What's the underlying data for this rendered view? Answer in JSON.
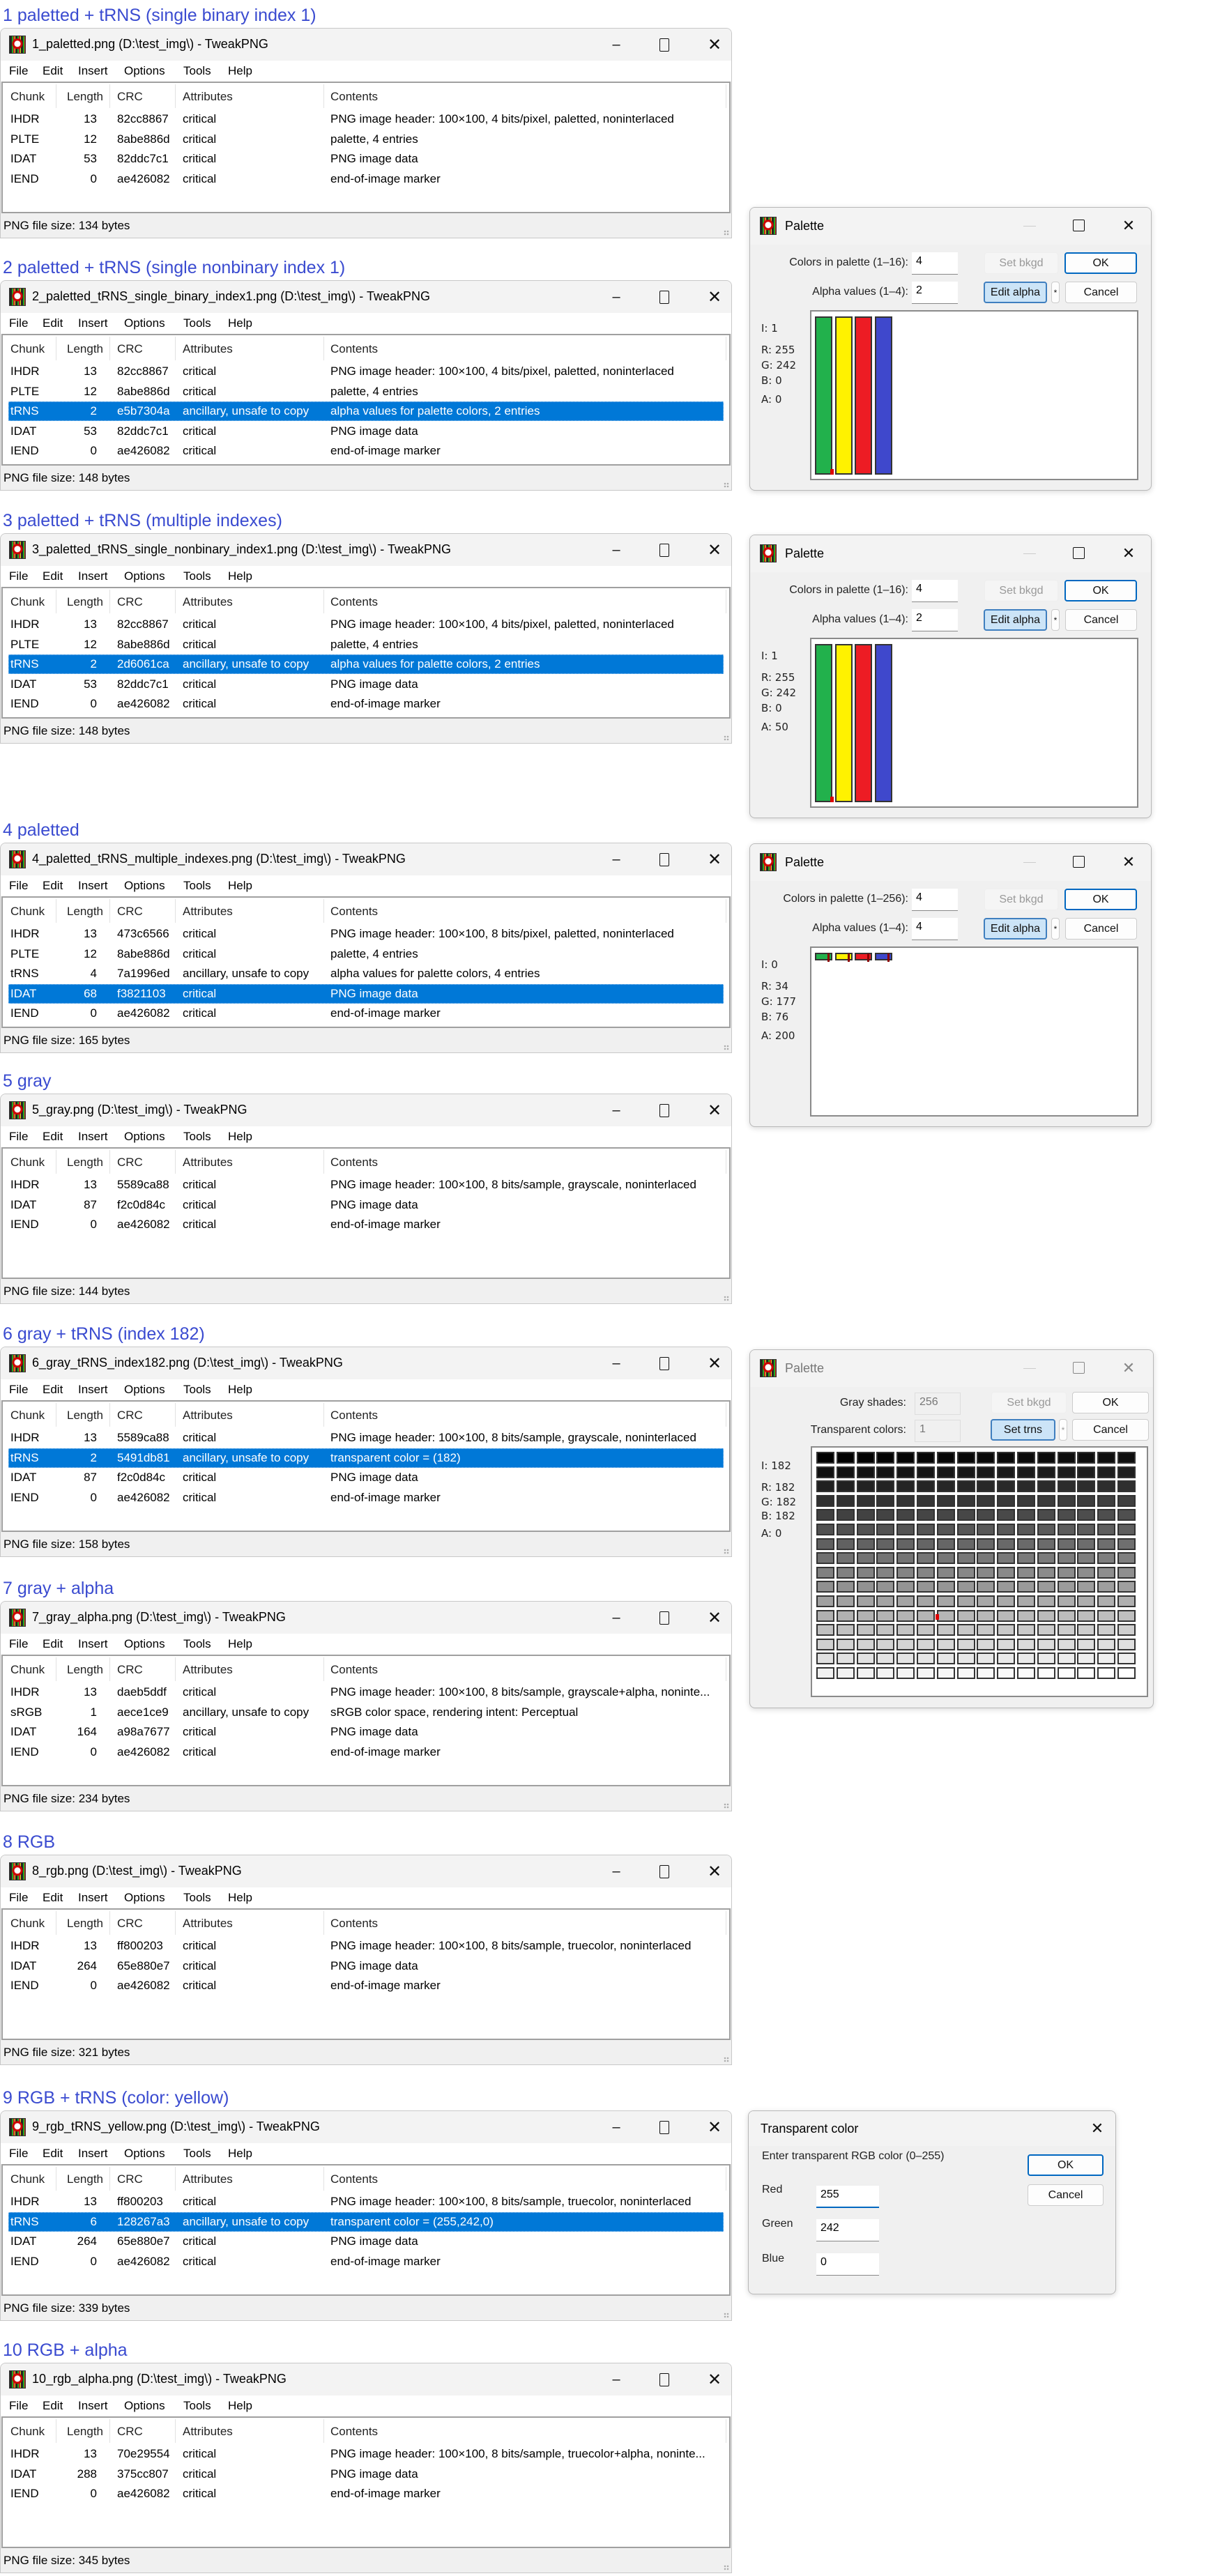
{
  "colors": {
    "accent": "#0078d7",
    "heading": "#3a4bd0"
  },
  "menu": [
    "File",
    "Edit",
    "Insert",
    "Options",
    "Tools",
    "Help"
  ],
  "columns": [
    "Chunk",
    "Length",
    "CRC",
    "Attributes",
    "Contents"
  ],
  "windows": [
    {
      "heading": "1 paletted + tRNS (single binary index 1)",
      "title": "1_paletted.png (D:\\test_img\\) - TweakPNG",
      "selected": -1,
      "status": "PNG file size: 134 bytes",
      "rows": [
        {
          "chunk": "IHDR",
          "length": "13",
          "crc": "82cc8867",
          "attributes": "critical",
          "contents": "PNG image header: 100×100, 4 bits/pixel, paletted, noninterlaced"
        },
        {
          "chunk": "PLTE",
          "length": "12",
          "crc": "8abe886d",
          "attributes": "critical",
          "contents": "palette, 4 entries"
        },
        {
          "chunk": "IDAT",
          "length": "53",
          "crc": "82ddc7c1",
          "attributes": "critical",
          "contents": "PNG image data"
        },
        {
          "chunk": "IEND",
          "length": "0",
          "crc": "ae426082",
          "attributes": "critical",
          "contents": "end-of-image marker"
        }
      ]
    },
    {
      "heading": "2 paletted + tRNS (single nonbinary index 1)",
      "title": "2_paletted_tRNS_single_binary_index1.png (D:\\test_img\\) - TweakPNG",
      "selected": 2,
      "status": "PNG file size: 148 bytes",
      "rows": [
        {
          "chunk": "IHDR",
          "length": "13",
          "crc": "82cc8867",
          "attributes": "critical",
          "contents": "PNG image header: 100×100, 4 bits/pixel, paletted, noninterlaced"
        },
        {
          "chunk": "PLTE",
          "length": "12",
          "crc": "8abe886d",
          "attributes": "critical",
          "contents": "palette, 4 entries"
        },
        {
          "chunk": "tRNS",
          "length": "2",
          "crc": "e5b7304a",
          "attributes": "ancillary, unsafe to copy",
          "contents": "alpha values for palette colors, 2 entries"
        },
        {
          "chunk": "IDAT",
          "length": "53",
          "crc": "82ddc7c1",
          "attributes": "critical",
          "contents": "PNG image data"
        },
        {
          "chunk": "IEND",
          "length": "0",
          "crc": "ae426082",
          "attributes": "critical",
          "contents": "end-of-image marker"
        }
      ]
    },
    {
      "heading": "3 paletted + tRNS (multiple indexes)",
      "title": "3_paletted_tRNS_single_nonbinary_index1.png (D:\\test_img\\) - TweakPNG",
      "selected": 2,
      "status": "PNG file size: 148 bytes",
      "rows": [
        {
          "chunk": "IHDR",
          "length": "13",
          "crc": "82cc8867",
          "attributes": "critical",
          "contents": "PNG image header: 100×100, 4 bits/pixel, paletted, noninterlaced"
        },
        {
          "chunk": "PLTE",
          "length": "12",
          "crc": "8abe886d",
          "attributes": "critical",
          "contents": "palette, 4 entries"
        },
        {
          "chunk": "tRNS",
          "length": "2",
          "crc": "2d6061ca",
          "attributes": "ancillary, unsafe to copy",
          "contents": "alpha values for palette colors, 2 entries"
        },
        {
          "chunk": "IDAT",
          "length": "53",
          "crc": "82ddc7c1",
          "attributes": "critical",
          "contents": "PNG image data"
        },
        {
          "chunk": "IEND",
          "length": "0",
          "crc": "ae426082",
          "attributes": "critical",
          "contents": "end-of-image marker"
        }
      ]
    },
    {
      "heading": "4 paletted",
      "title": "4_paletted_tRNS_multiple_indexes.png (D:\\test_img\\) - TweakPNG",
      "selected": 3,
      "status": "PNG file size: 165 bytes",
      "rows": [
        {
          "chunk": "IHDR",
          "length": "13",
          "crc": "473c6566",
          "attributes": "critical",
          "contents": "PNG image header: 100×100, 8 bits/pixel, paletted, noninterlaced"
        },
        {
          "chunk": "PLTE",
          "length": "12",
          "crc": "8abe886d",
          "attributes": "critical",
          "contents": "palette, 4 entries"
        },
        {
          "chunk": "tRNS",
          "length": "4",
          "crc": "7a1996ed",
          "attributes": "ancillary, unsafe to copy",
          "contents": "alpha values for palette colors, 4 entries"
        },
        {
          "chunk": "IDAT",
          "length": "68",
          "crc": "f3821103",
          "attributes": "critical",
          "contents": "PNG image data"
        },
        {
          "chunk": "IEND",
          "length": "0",
          "crc": "ae426082",
          "attributes": "critical",
          "contents": "end-of-image marker"
        }
      ]
    },
    {
      "heading": "5 gray",
      "title": "5_gray.png (D:\\test_img\\) - TweakPNG",
      "selected": -1,
      "status": "PNG file size: 144 bytes",
      "rows": [
        {
          "chunk": "IHDR",
          "length": "13",
          "crc": "5589ca88",
          "attributes": "critical",
          "contents": "PNG image header: 100×100, 8 bits/sample, grayscale, noninterlaced"
        },
        {
          "chunk": "IDAT",
          "length": "87",
          "crc": "f2c0d84c",
          "attributes": "critical",
          "contents": "PNG image data"
        },
        {
          "chunk": "IEND",
          "length": "0",
          "crc": "ae426082",
          "attributes": "critical",
          "contents": "end-of-image marker"
        }
      ]
    },
    {
      "heading": "6 gray + tRNS (index 182)",
      "title": "6_gray_tRNS_index182.png (D:\\test_img\\) - TweakPNG",
      "selected": 1,
      "status": "PNG file size: 158 bytes",
      "rows": [
        {
          "chunk": "IHDR",
          "length": "13",
          "crc": "5589ca88",
          "attributes": "critical",
          "contents": "PNG image header: 100×100, 8 bits/sample, grayscale, noninterlaced"
        },
        {
          "chunk": "tRNS",
          "length": "2",
          "crc": "5491db81",
          "attributes": "ancillary, unsafe to copy",
          "contents": "transparent color = (182)"
        },
        {
          "chunk": "IDAT",
          "length": "87",
          "crc": "f2c0d84c",
          "attributes": "critical",
          "contents": "PNG image data"
        },
        {
          "chunk": "IEND",
          "length": "0",
          "crc": "ae426082",
          "attributes": "critical",
          "contents": "end-of-image marker"
        }
      ]
    },
    {
      "heading": "7 gray + alpha",
      "title": "7_gray_alpha.png (D:\\test_img\\) - TweakPNG",
      "selected": -1,
      "status": "PNG file size: 234 bytes",
      "rows": [
        {
          "chunk": "IHDR",
          "length": "13",
          "crc": "daeb5ddf",
          "attributes": "critical",
          "contents": "PNG image header: 100×100, 8 bits/sample, grayscale+alpha, noninte..."
        },
        {
          "chunk": "sRGB",
          "length": "1",
          "crc": "aece1ce9",
          "attributes": "ancillary, unsafe to copy",
          "contents": "sRGB color space, rendering intent: Perceptual"
        },
        {
          "chunk": "IDAT",
          "length": "164",
          "crc": "a98a7677",
          "attributes": "critical",
          "contents": "PNG image data"
        },
        {
          "chunk": "IEND",
          "length": "0",
          "crc": "ae426082",
          "attributes": "critical",
          "contents": "end-of-image marker"
        }
      ]
    },
    {
      "heading": "8 RGB",
      "title": "8_rgb.png (D:\\test_img\\) - TweakPNG",
      "selected": -1,
      "status": "PNG file size: 321 bytes",
      "rows": [
        {
          "chunk": "IHDR",
          "length": "13",
          "crc": "ff800203",
          "attributes": "critical",
          "contents": "PNG image header: 100×100, 8 bits/sample, truecolor, noninterlaced"
        },
        {
          "chunk": "IDAT",
          "length": "264",
          "crc": "65e880e7",
          "attributes": "critical",
          "contents": "PNG image data"
        },
        {
          "chunk": "IEND",
          "length": "0",
          "crc": "ae426082",
          "attributes": "critical",
          "contents": "end-of-image marker"
        }
      ]
    },
    {
      "heading": "9 RGB + tRNS (color: yellow)",
      "title": "9_rgb_tRNS_yellow.png (D:\\test_img\\) - TweakPNG",
      "selected": 1,
      "status": "PNG file size: 339 bytes",
      "rows": [
        {
          "chunk": "IHDR",
          "length": "13",
          "crc": "ff800203",
          "attributes": "critical",
          "contents": "PNG image header: 100×100, 8 bits/sample, truecolor, noninterlaced"
        },
        {
          "chunk": "tRNS",
          "length": "6",
          "crc": "128267a3",
          "attributes": "ancillary, unsafe to copy",
          "contents": "transparent color = (255,242,0)"
        },
        {
          "chunk": "IDAT",
          "length": "264",
          "crc": "65e880e7",
          "attributes": "critical",
          "contents": "PNG image data"
        },
        {
          "chunk": "IEND",
          "length": "0",
          "crc": "ae426082",
          "attributes": "critical",
          "contents": "end-of-image marker"
        }
      ]
    },
    {
      "heading": "10 RGB + alpha",
      "title": "10_rgb_alpha.png (D:\\test_img\\) - TweakPNG",
      "selected": -1,
      "status": "PNG file size: 345 bytes",
      "rows": [
        {
          "chunk": "IHDR",
          "length": "13",
          "crc": "70e29554",
          "attributes": "critical",
          "contents": "PNG image header: 100×100, 8 bits/sample, truecolor+alpha, noninte..."
        },
        {
          "chunk": "IDAT",
          "length": "288",
          "crc": "375cc807",
          "attributes": "critical",
          "contents": "PNG image data"
        },
        {
          "chunk": "IEND",
          "length": "0",
          "crc": "ae426082",
          "attributes": "critical",
          "contents": "end-of-image marker"
        }
      ]
    }
  ],
  "palette_dialogs": [
    {
      "title": "Palette",
      "colors_label": "Colors in palette (1–16):",
      "colors_value": "4",
      "alpha_label": "Alpha values (1–4):",
      "alpha_value": "2",
      "set_bkgd": "Set bkgd",
      "edit_alpha": "Edit alpha",
      "asterisk": "*",
      "ok": "OK",
      "cancel": "Cancel",
      "info": {
        "i": "I: 1",
        "r": "R: 255",
        "g": "G: 242",
        "b": "B: 0",
        "a": "A: 0"
      },
      "swatches": [
        "#22b14c",
        "#fff200",
        "#ed1c24",
        "#3f48cc"
      ]
    },
    {
      "title": "Palette",
      "colors_label": "Colors in palette (1–16):",
      "colors_value": "4",
      "alpha_label": "Alpha values (1–4):",
      "alpha_value": "2",
      "set_bkgd": "Set bkgd",
      "edit_alpha": "Edit alpha",
      "asterisk": "*",
      "ok": "OK",
      "cancel": "Cancel",
      "info": {
        "i": "I: 1",
        "r": "R: 255",
        "g": "G: 242",
        "b": "B: 0",
        "a": "A: 50"
      },
      "swatches": [
        "#22b14c",
        "#fff200",
        "#ed1c24",
        "#3f48cc"
      ]
    },
    {
      "title": "Palette",
      "colors_label": "Colors in palette (1–256):",
      "colors_value": "4",
      "alpha_label": "Alpha values (1–4):",
      "alpha_value": "4",
      "set_bkgd": "Set bkgd",
      "edit_alpha": "Edit alpha",
      "asterisk": "*",
      "ok": "OK",
      "cancel": "Cancel",
      "info": {
        "i": "I: 0",
        "r": "R: 34",
        "g": "G: 177",
        "b": "B: 76",
        "a": "A: 200"
      },
      "swatches": [
        "#22b14c",
        "#fff200",
        "#ed1c24",
        "#3f48cc"
      ]
    }
  ],
  "gray_dialog": {
    "title": "Palette",
    "shades_label": "Gray shades:",
    "shades_value": "256",
    "trans_label": "Transparent colors:",
    "trans_value": "1",
    "set_bkgd": "Set bkgd",
    "set_trns": "Set trns",
    "asterisk": "*",
    "ok": "OK",
    "cancel": "Cancel",
    "info": {
      "i": "I: 182",
      "r": "R: 182",
      "g": "G: 182",
      "b": "B: 182",
      "a": "A: 0"
    },
    "cell_count": 256,
    "selected_index": 182
  },
  "transparent_dialog": {
    "title": "Transparent color",
    "prompt": "Enter transparent RGB color (0–255)",
    "red_label": "Red",
    "red_value": "255",
    "green_label": "Green",
    "green_value": "242",
    "blue_label": "Blue",
    "blue_value": "0",
    "ok": "OK",
    "cancel": "Cancel"
  }
}
